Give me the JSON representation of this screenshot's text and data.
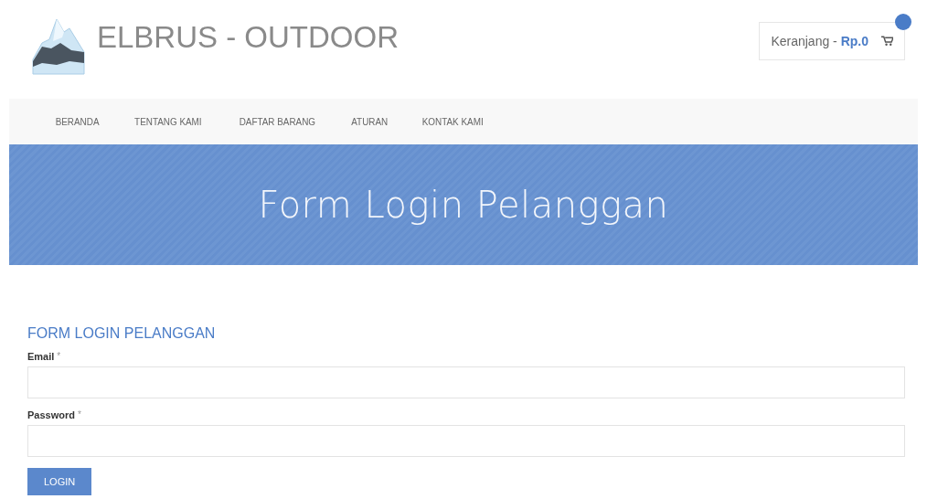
{
  "brand": {
    "title": "ELBRUS - OUTDOOR"
  },
  "cart": {
    "label": "Keranjang - ",
    "amount": "Rp.0"
  },
  "nav": [
    {
      "label": "BERANDA"
    },
    {
      "label": "TENTANG KAMI"
    },
    {
      "label": "DAFTAR BARANG"
    },
    {
      "label": "ATURAN"
    },
    {
      "label": "KONTAK KAMI"
    }
  ],
  "banner": {
    "title": "Form Login Pelanggan"
  },
  "form": {
    "heading": "FORM LOGIN PELANGGAN",
    "fields": [
      {
        "label": "Email",
        "required_mark": "*"
      },
      {
        "label": "Password",
        "required_mark": "*"
      }
    ],
    "submit": "LOGIN"
  }
}
